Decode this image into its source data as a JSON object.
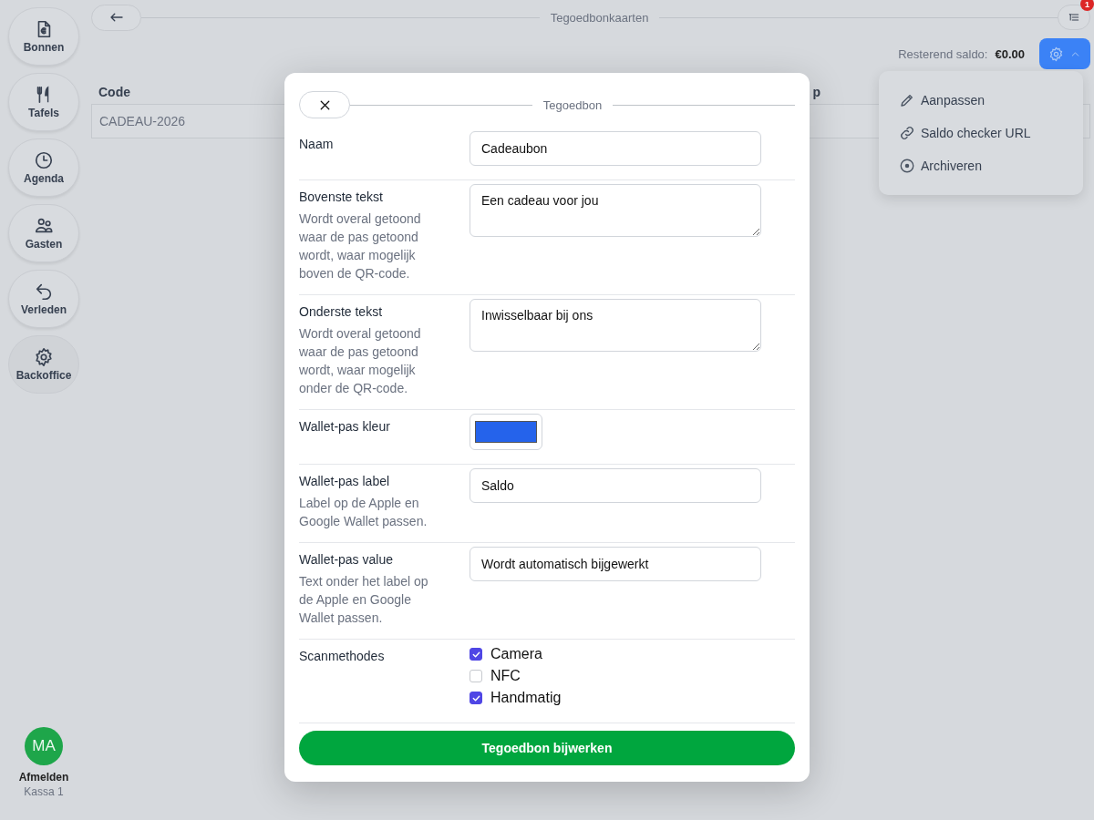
{
  "sidebar": {
    "items": [
      {
        "label": "Bonnen",
        "kind": "receipt",
        "selected": false
      },
      {
        "label": "Tafels",
        "kind": "cutlery",
        "selected": false
      },
      {
        "label": "Agenda",
        "kind": "clock",
        "selected": false
      },
      {
        "label": "Gasten",
        "kind": "people",
        "selected": false
      },
      {
        "label": "Verleden",
        "kind": "undo",
        "selected": false
      },
      {
        "label": "Backoffice",
        "kind": "gear",
        "selected": true
      }
    ],
    "user": {
      "initials": "MA",
      "action": "Afmelden",
      "register": "Kassa 1"
    }
  },
  "header": {
    "title": "Tegoedbonkaarten",
    "notification_count": "1"
  },
  "balance": {
    "label": "Resterend saldo:",
    "value": "€0.00"
  },
  "menu": {
    "expanded": true,
    "items": [
      {
        "label": "Aanpassen",
        "kind": "pencil"
      },
      {
        "label": "Saldo checker URL",
        "kind": "link"
      },
      {
        "label": "Archiveren",
        "kind": "archive"
      }
    ]
  },
  "table": {
    "columns": [
      "Code",
      "p"
    ],
    "rows": [
      [
        "CADEAU-2026"
      ]
    ]
  },
  "modal": {
    "title": "Tegoedbon",
    "fields": [
      {
        "kind": "text",
        "label": "Naam",
        "value": "Cadeaubon"
      },
      {
        "kind": "textarea",
        "label": "Bovenste tekst",
        "help": "Wordt overal getoond waar de pas getoond wordt, waar mogelijk boven de QR-code.",
        "value": "Een cadeau voor jou"
      },
      {
        "kind": "textarea",
        "label": "Onderste tekst",
        "help": "Wordt overal getoond waar de pas getoond wordt, waar mogelijk onder de QR-code.",
        "value": "Inwisselbaar bij ons"
      },
      {
        "kind": "color",
        "label": "Wallet-pas kleur",
        "color": "#2563eb"
      },
      {
        "kind": "text",
        "label": "Wallet-pas label",
        "help": "Label op de Apple en Google Wallet passen.",
        "value": "Saldo"
      },
      {
        "kind": "text",
        "label": "Wallet-pas value",
        "help": "Text onder het label op de Apple en Google Wallet passen.",
        "value": "Wordt automatisch bijgewerkt"
      },
      {
        "kind": "checkboxes",
        "label": "Scanmethodes",
        "options": [
          {
            "label": "Camera",
            "checked": true
          },
          {
            "label": "NFC",
            "checked": false
          },
          {
            "label": "Handmatig",
            "checked": true
          }
        ]
      }
    ],
    "submit": "Tegoedbon bijwerken"
  }
}
